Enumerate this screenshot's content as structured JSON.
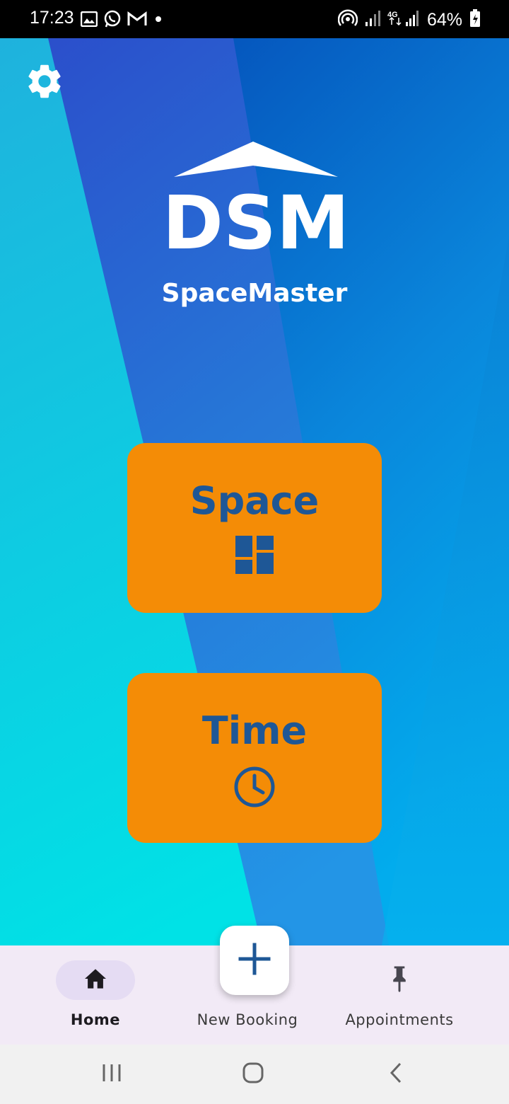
{
  "status_bar": {
    "time": "17:23",
    "battery_percent": "64%",
    "left_icons": [
      "gallery-icon",
      "whatsapp-icon",
      "gmail-icon",
      "dot-icon"
    ],
    "right_icons": [
      "hotspot-icon",
      "signal-icon",
      "4g-signal-icon",
      "battery-icon"
    ]
  },
  "header": {
    "logo_text": "DSM",
    "app_name": "SpaceMaster",
    "settings_icon": "gear-icon"
  },
  "cards": {
    "space": {
      "label": "Space",
      "icon": "dashboard-grid-icon"
    },
    "time": {
      "label": "Time",
      "icon": "clock-icon"
    }
  },
  "bottom_nav": {
    "home": {
      "label": "Home",
      "icon": "home-icon",
      "active": true
    },
    "new_booking": {
      "label": "New Booking",
      "icon": "plus-icon"
    },
    "appointments": {
      "label": "Appointments",
      "icon": "pin-icon"
    }
  },
  "system_nav": [
    "recents-icon",
    "home-circle-icon",
    "back-icon"
  ],
  "colors": {
    "card_bg": "#f48c06",
    "card_text": "#1e5796",
    "nav_bg": "#f2eaf6",
    "nav_active_pill": "#e5dcf3",
    "fab_icon": "#1e5796",
    "bg_cyan": "#00c6e2",
    "bg_blue": "#1f63cf"
  }
}
